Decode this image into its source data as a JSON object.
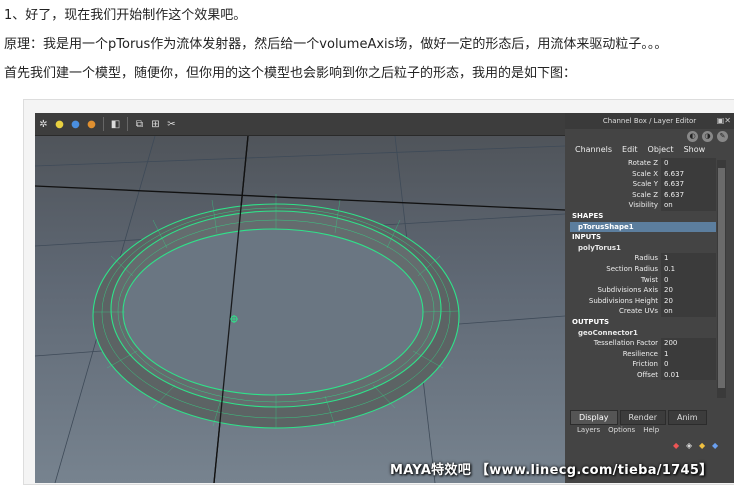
{
  "text_lines": {
    "line1": "1、好了，现在我们开始制作这个效果吧。",
    "line2": "原理：我是用一个pTorus作为流体发射器，然后给一个volumeAxis场，做好一定的形态后，用流体来驱动粒子。。。",
    "line3": "首先我们建一个模型，随便你，但你用的这个模型也会影响到你之后粒子的形态，我用的是如下图："
  },
  "maya": {
    "channel_box": {
      "title": "Channel Box / Layer Editor",
      "menu": [
        "Channels",
        "Edit",
        "Object",
        "Show"
      ],
      "attributes": [
        {
          "label": "Rotate Z",
          "value": "0"
        },
        {
          "label": "Scale X",
          "value": "6.637"
        },
        {
          "label": "Scale Y",
          "value": "6.637"
        },
        {
          "label": "Scale Z",
          "value": "6.637"
        },
        {
          "label": "Visibility",
          "value": "on"
        }
      ],
      "shapes_header": "SHAPES",
      "shape_node": "pTorusShape1",
      "inputs_header": "INPUTS",
      "input_node": "polyTorus1",
      "input_attributes": [
        {
          "label": "Radius",
          "value": "1"
        },
        {
          "label": "Section Radius",
          "value": "0.1"
        },
        {
          "label": "Twist",
          "value": "0"
        },
        {
          "label": "Subdivisions Axis",
          "value": "20"
        },
        {
          "label": "Subdivisions Height",
          "value": "20"
        },
        {
          "label": "Create UVs",
          "value": "on"
        }
      ],
      "outputs_header": "OUTPUTS",
      "output_node": "geoConnector1",
      "output_attributes": [
        {
          "label": "Tessellation Factor",
          "value": "200"
        },
        {
          "label": "Resilience",
          "value": "1"
        },
        {
          "label": "Friction",
          "value": "0"
        },
        {
          "label": "Offset",
          "value": "0.01"
        }
      ]
    },
    "layer_editor": {
      "tabs": [
        "Display",
        "Render",
        "Anim"
      ],
      "submenu": [
        "Layers",
        "Options",
        "Help"
      ]
    },
    "watermark": "MAYA特效吧 【www.linecg.com/tieba/1745】"
  }
}
